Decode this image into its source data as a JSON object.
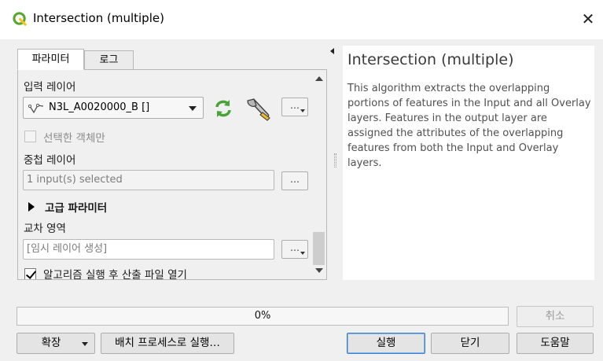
{
  "window": {
    "title": "Intersection (multiple)",
    "close_glyph": "✕"
  },
  "tabs": [
    {
      "label": "파라미터"
    },
    {
      "label": "로그"
    }
  ],
  "params": {
    "input_layer_label": "입력 레이어",
    "input_layer_value": "N3L_A0020000_B []",
    "selected_only_label": "선택한 객체만",
    "overlay_label": "중첩 레이어",
    "overlay_value": "1 input(s) selected",
    "advanced_label": "고급 파라미터",
    "intersection_label": "교차 영역",
    "intersection_placeholder": "[임시 레이어 생성]",
    "open_output_label": "알고리즘 실행 후 산출 파일 열기",
    "open_output_checked": true,
    "dots": "…"
  },
  "help": {
    "title": "Intersection (multiple)",
    "body": "This algorithm extracts the overlapping portions of features in the Input and all Overlay layers. Features in the output layer are assigned the attributes of the overlapping features from both the Input and Overlay layers."
  },
  "progress": {
    "text": "0%",
    "value": 0
  },
  "buttons": {
    "cancel": "취소",
    "expand": "확장",
    "batch": "배치 프로세스로 실행…",
    "run": "실행",
    "close": "닫기",
    "help": "도움말"
  },
  "colors": {
    "qgis_green": "#58a62e",
    "refresh_green": "#4aa33a",
    "focus_blue": "#3c7fd1"
  }
}
